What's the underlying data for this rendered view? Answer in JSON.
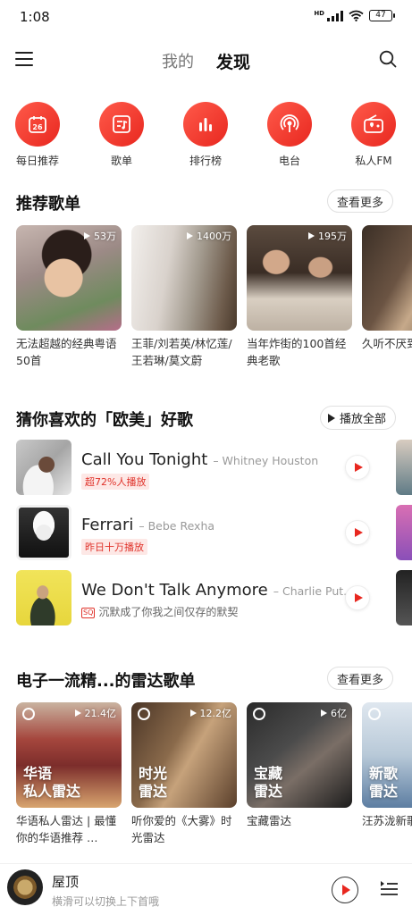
{
  "status": {
    "time": "1:08",
    "battery": "47",
    "signal_label": "HD"
  },
  "header": {
    "tab_mine": "我的",
    "tab_discover": "发现"
  },
  "quick_links": [
    {
      "label": "每日推荐",
      "icon": "calendar-icon",
      "badge": "26"
    },
    {
      "label": "歌单",
      "icon": "playlist-icon"
    },
    {
      "label": "排行榜",
      "icon": "chart-icon"
    },
    {
      "label": "电台",
      "icon": "radio-podcast-icon"
    },
    {
      "label": "私人FM",
      "icon": "fm-radio-icon"
    }
  ],
  "recommended": {
    "title": "推荐歌单",
    "more": "查看更多",
    "playlists": [
      {
        "count": "53万",
        "name": "无法超越的经典粤语50首"
      },
      {
        "count": "1400万",
        "name": "王菲/刘若英/林忆莲/王若琳/莫文蔚"
      },
      {
        "count": "195万",
        "name": "当年炸街的100首经典老歌"
      },
      {
        "count": "",
        "name": "久听不厌到耳朵怀孕"
      }
    ]
  },
  "guess": {
    "title": "猜你喜欢的「欧美」好歌",
    "play_all": "播放全部",
    "songs": [
      {
        "title": "Call You Tonight",
        "artist": "– Whitney Houston",
        "tag": "超72%人播放",
        "sub": ""
      },
      {
        "title": "Ferrari",
        "artist": "– Bebe Rexha",
        "tag": "昨日十万播放",
        "sub": ""
      },
      {
        "title": "We Don't Talk Anymore",
        "artist": "– Charlie Put…",
        "tag": "",
        "quality": "SQ",
        "sub": "沉默成了你我之间仅存的默契"
      }
    ]
  },
  "radar": {
    "title": "电子一流精...的雷达歌单",
    "more": "查看更多",
    "playlists": [
      {
        "count": "21.4亿",
        "label_line1": "华语",
        "label_line2": "私人雷达",
        "name": "华语私人雷达 | 最懂你的华语推荐 …"
      },
      {
        "count": "12.2亿",
        "label_line1": "时光",
        "label_line2": "雷达",
        "name": "听你爱的《大雾》时光雷达"
      },
      {
        "count": "6亿",
        "label_line1": "宝藏",
        "label_line2": "雷达",
        "name": "宝藏雷达"
      },
      {
        "count": "",
        "label_line1": "新歌",
        "label_line2": "雷达",
        "name": "汪苏泷新歌热听|新歌"
      }
    ]
  },
  "player": {
    "title": "屋顶",
    "hint": "横滑可以切换上下首哦"
  }
}
